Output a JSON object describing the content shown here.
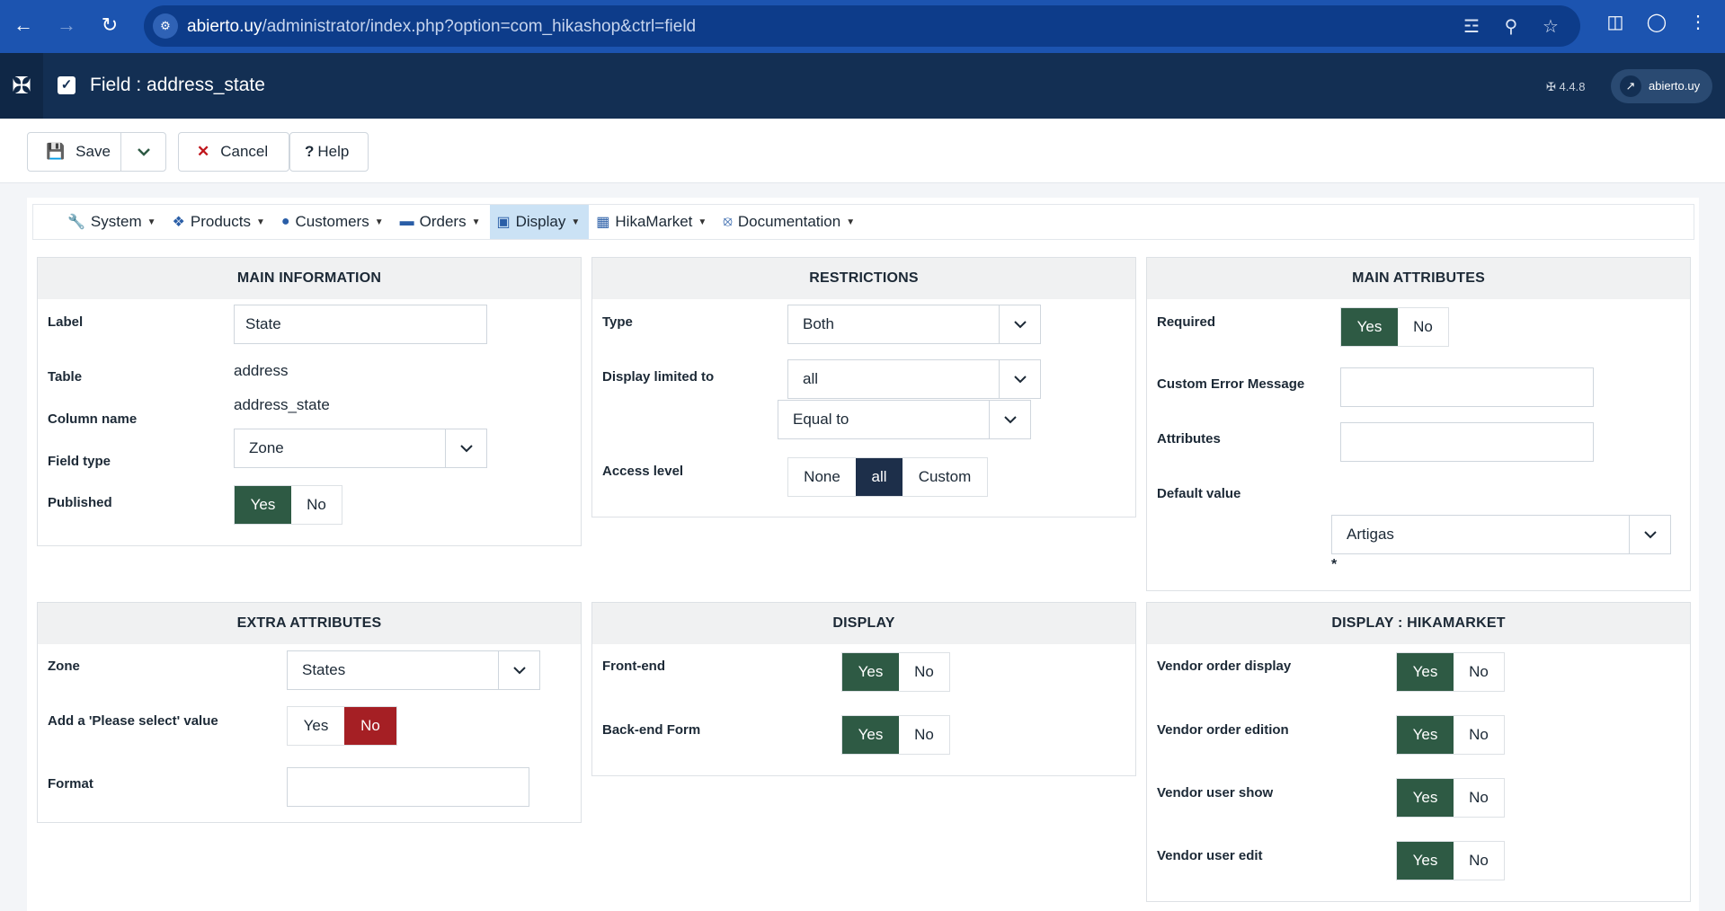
{
  "browser": {
    "url_domain": "abierto.uy",
    "url_path": "/administrator/index.php?option=com_hikashop&ctrl=field"
  },
  "header": {
    "title": "Field : address_state",
    "version": "4.4.8",
    "site_label": "abierto.uy"
  },
  "toolbar": {
    "save": "Save",
    "cancel": "Cancel",
    "help": "Help"
  },
  "menu": {
    "system": "System",
    "products": "Products",
    "customers": "Customers",
    "orders": "Orders",
    "display": "Display",
    "hikamarket": "HikaMarket",
    "documentation": "Documentation"
  },
  "main_info": {
    "title": "MAIN INFORMATION",
    "label_label": "Label",
    "label_value": "State",
    "table_label": "Table",
    "table_value": "address",
    "column_label": "Column name",
    "column_value": "address_state",
    "fieldtype_label": "Field type",
    "fieldtype_value": "Zone",
    "published_label": "Published",
    "yes": "Yes",
    "no": "No"
  },
  "restrictions": {
    "title": "RESTRICTIONS",
    "type_label": "Type",
    "type_value": "Both",
    "display_limited_label": "Display limited to",
    "display_limited_value": "all",
    "operator_value": "Equal to",
    "access_label": "Access level",
    "access_none": "None",
    "access_all": "all",
    "access_custom": "Custom"
  },
  "main_attributes": {
    "title": "MAIN ATTRIBUTES",
    "required_label": "Required",
    "yes": "Yes",
    "no": "No",
    "custom_error_label": "Custom Error Message",
    "custom_error_value": "",
    "attributes_label": "Attributes",
    "attributes_value": "",
    "default_label": "Default value",
    "default_value": "Artigas",
    "asterisk": "*"
  },
  "extra_attributes": {
    "title": "EXTRA ATTRIBUTES",
    "zone_label": "Zone",
    "zone_value": "States",
    "please_select_label": "Add a 'Please select' value",
    "yes": "Yes",
    "no": "No",
    "format_label": "Format",
    "format_value": ""
  },
  "display": {
    "title": "DISPLAY",
    "frontend_label": "Front-end",
    "backend_label": "Back-end Form",
    "yes": "Yes",
    "no": "No"
  },
  "display_hikamarket": {
    "title": "DISPLAY : HIKAMARKET",
    "vendor_order_display": "Vendor order display",
    "vendor_order_edition": "Vendor order edition",
    "vendor_user_show": "Vendor user show",
    "vendor_user_edit": "Vendor user edit",
    "yes": "Yes",
    "no": "No"
  }
}
